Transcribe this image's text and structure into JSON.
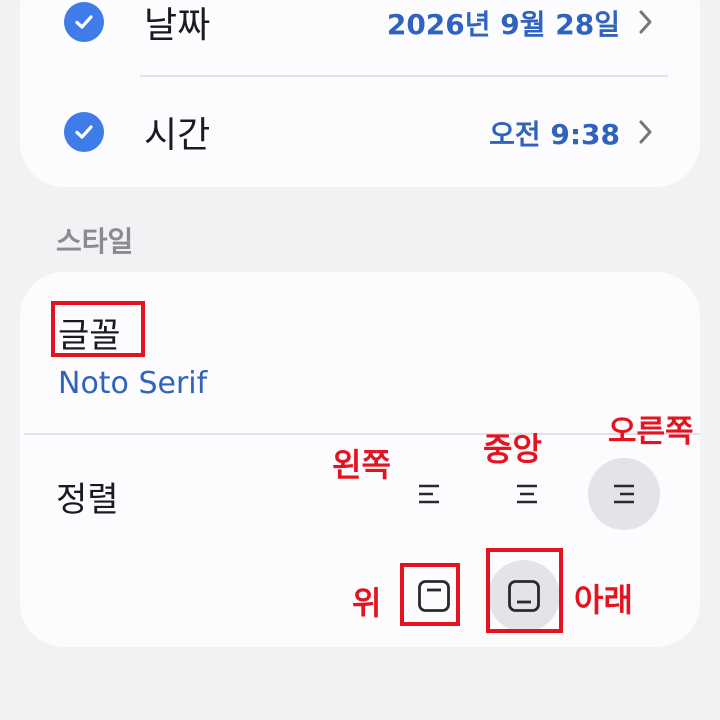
{
  "datetime": {
    "date_label": "날짜",
    "date_value": "2026년 9월 28일",
    "time_label": "시간",
    "time_value": "오전 9:38"
  },
  "style_section": {
    "title": "스타일",
    "font_label": "글꼴",
    "font_value": "Noto Serif",
    "alignment_label": "정렬",
    "horizontal_options": [
      "left",
      "center",
      "right"
    ],
    "horizontal_selected": "right",
    "vertical_options": [
      "top",
      "bottom"
    ],
    "vertical_selected": "bottom"
  },
  "annotations": {
    "left": "왼쪽",
    "center": "중앙",
    "right": "오른쪽",
    "top": "위",
    "bottom": "아래"
  },
  "colors": {
    "accent": "#3f7be9",
    "value_text": "#2f63bd",
    "annotation": "#e3141f"
  },
  "icons": [
    "check-icon",
    "chevron-right-icon",
    "align-left-icon",
    "align-center-icon",
    "align-right-icon",
    "align-top-icon",
    "align-bottom-icon"
  ]
}
